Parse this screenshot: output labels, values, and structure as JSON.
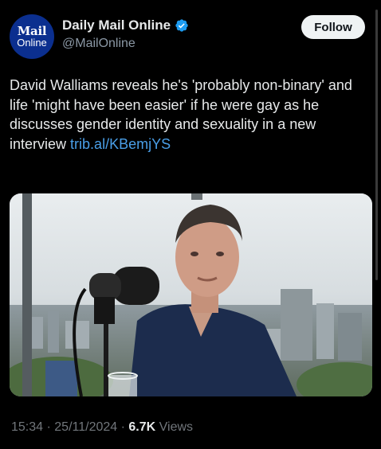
{
  "account": {
    "avatar_line1": "Mail",
    "avatar_line2": "Online",
    "display_name": "Daily Mail Online",
    "handle": "@MailOnline",
    "verified_icon": "verified-badge-icon",
    "follow_label": "Follow"
  },
  "tweet": {
    "text": "David Walliams reveals he's 'probably non-binary' and life 'might have been easier' if he were gay as he discusses gender identity and sexuality in a new interview",
    "link": "trib.al/KBemjYS"
  },
  "media": {
    "description_icon": "video-thumbnail"
  },
  "meta": {
    "time": "15:34",
    "separator": "·",
    "date": "25/11/2024",
    "views_count": "6.7K",
    "views_label": "Views"
  },
  "colors": {
    "background": "#000000",
    "text": "#e7e9ea",
    "secondary": "#71767b",
    "link": "#4a9fe8",
    "verified": "#1d9bf0",
    "avatar": "#0b2f8f"
  }
}
